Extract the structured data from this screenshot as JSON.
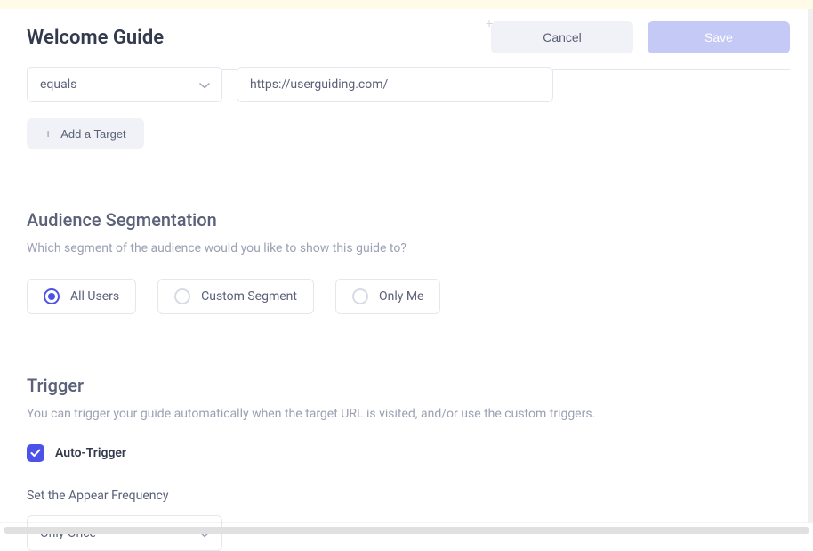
{
  "header": {
    "title": "Welcome Guide",
    "cancel_label": "Cancel",
    "save_label": "Save"
  },
  "target": {
    "condition": "equals",
    "url": "https://userguiding.com/",
    "add_label": "Add a Target"
  },
  "audience": {
    "title": "Audience Segmentation",
    "description": "Which segment of the audience would you like to show this guide to?",
    "options": [
      {
        "label": "All Users",
        "selected": true
      },
      {
        "label": "Custom Segment",
        "selected": false
      },
      {
        "label": "Only Me",
        "selected": false
      }
    ]
  },
  "trigger": {
    "title": "Trigger",
    "description": "You can trigger your guide automatically when the target URL is visited, and/or use the custom triggers.",
    "auto_trigger_label": "Auto-Trigger",
    "auto_trigger_checked": true,
    "frequency_label": "Set the Appear Frequency",
    "frequency_value": "Only Once"
  }
}
